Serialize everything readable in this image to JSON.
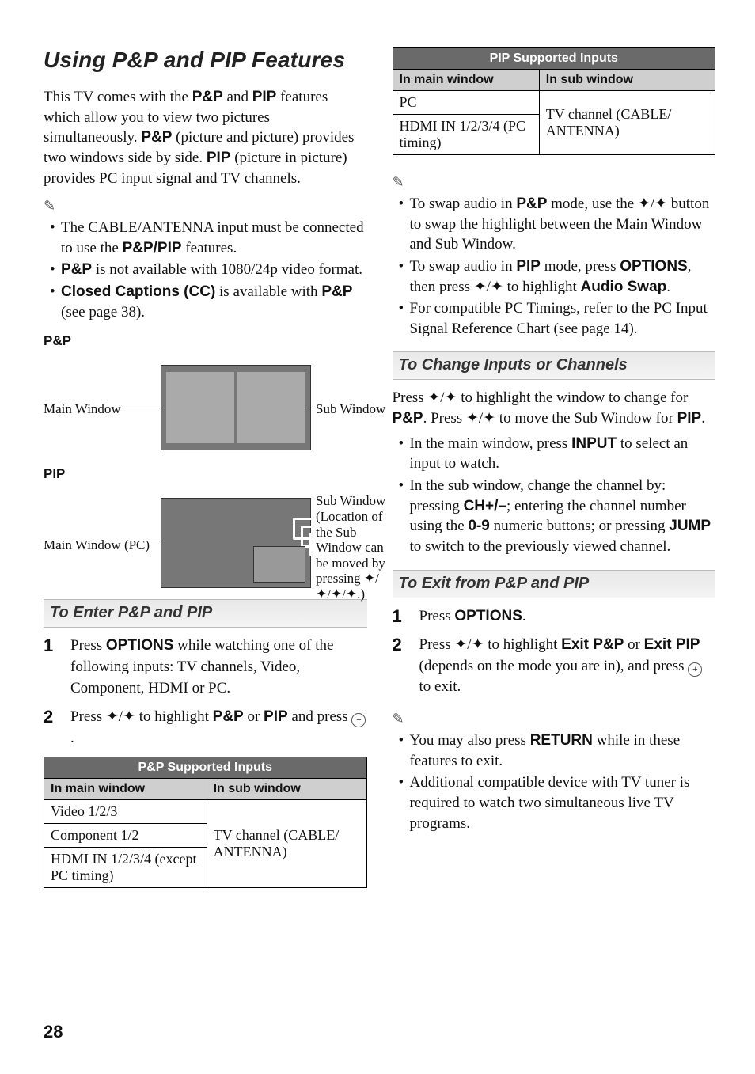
{
  "title": "Using P&P and PIP Features",
  "intro_parts": [
    "This TV comes with the ",
    "P&P",
    " and ",
    "PIP",
    " features which allow you to view two pictures simultaneously. ",
    "P&P",
    " (picture and picture) provides two windows side by side. ",
    "PIP",
    " (picture in picture) provides PC input signal and TV channels."
  ],
  "note_icon": "✎",
  "left_notes": [
    {
      "pre": "The CABLE/ANTENNA input must be connected to use the ",
      "bold": "P&P/PIP",
      "post": " features."
    },
    {
      "bold_first": "P&P",
      "post": " is not available with 1080/24p video format."
    },
    {
      "bold_first": "Closed Captions (CC)",
      "post": " is available with ",
      "bold2": "P&P",
      "post2": " (see page 38)."
    }
  ],
  "pp_label": "P&P",
  "pp_diagram": {
    "left": "Main Window",
    "right": "Sub Window"
  },
  "pip_label": "PIP",
  "pip_diagram": {
    "left": "Main Window (PC)",
    "right": "Sub Window (Location of the Sub Window can be moved by pressing ✦/✦/✦/✦.)"
  },
  "enter_heading": "To Enter P&P and PIP",
  "enter_steps": [
    {
      "parts": [
        "Press ",
        {
          "b": "OPTIONS"
        },
        " while watching one of the following inputs: TV channels, Video, Component, HDMI or PC."
      ]
    },
    {
      "parts": [
        "Press ✦/✦ to highlight ",
        {
          "b": "P&P"
        },
        " or ",
        {
          "b": "PIP"
        },
        " and press ",
        {
          "enter": true
        },
        "."
      ]
    }
  ],
  "table_pp": {
    "caption": "P&P Supported Inputs",
    "h1": "In main window",
    "h2": "In sub window",
    "main_rows": [
      "Video 1/2/3",
      "Component 1/2",
      "HDMI IN 1/2/3/4 (except PC timing)"
    ],
    "sub": "TV channel (CABLE/ ANTENNA)"
  },
  "table_pip": {
    "caption": "PIP Supported Inputs",
    "h1": "In main window",
    "h2": "In sub window",
    "main_rows": [
      "PC",
      "HDMI IN 1/2/3/4 (PC timing)"
    ],
    "sub": "TV channel (CABLE/ ANTENNA)"
  },
  "right_notes_top": [
    {
      "parts": [
        "To swap audio in ",
        {
          "b": "P&P"
        },
        " mode, use the ✦/✦ button to swap the highlight between the Main Window and Sub Window."
      ]
    },
    {
      "parts": [
        "To swap audio in ",
        {
          "b": "PIP"
        },
        " mode, press ",
        {
          "b": "OPTIONS"
        },
        ", then press ✦/✦ to highlight ",
        {
          "b": "Audio Swap"
        },
        "."
      ]
    },
    {
      "parts": [
        "For compatible PC Timings, refer to the PC Input Signal Reference Chart (see page 14)."
      ]
    }
  ],
  "change_heading": "To Change Inputs or Channels",
  "change_intro_parts": [
    "Press ✦/✦ to highlight the window to change for ",
    {
      "b": "P&P"
    },
    ". Press ✦/✦ to move the Sub Window for ",
    {
      "b": "PIP"
    },
    "."
  ],
  "change_bullets": [
    {
      "parts": [
        "In the main window, press ",
        {
          "b": "INPUT"
        },
        " to select an input to watch."
      ]
    },
    {
      "parts": [
        "In the sub window, change the channel by: pressing ",
        {
          "b": "CH+/–"
        },
        "; entering the channel number using the ",
        {
          "b": "0-9"
        },
        " numeric buttons; or pressing ",
        {
          "b": "JUMP"
        },
        " to switch to the previously viewed channel."
      ]
    }
  ],
  "exit_heading": "To Exit from P&P and PIP",
  "exit_steps": [
    {
      "parts": [
        "Press ",
        {
          "b": "OPTIONS"
        },
        "."
      ]
    },
    {
      "parts": [
        "Press ✦/✦ to highlight ",
        {
          "b": "Exit P&P"
        },
        " or ",
        {
          "b": "Exit PIP"
        },
        " (depends on the mode you are in), and press ",
        {
          "enter": true
        },
        " to exit."
      ]
    }
  ],
  "exit_notes": [
    {
      "parts": [
        "You may also press ",
        {
          "b": "RETURN"
        },
        " while in these features to exit."
      ]
    },
    {
      "parts": [
        "Additional compatible device with TV tuner is required to watch two simultaneous live TV programs."
      ]
    }
  ],
  "page_number": "28"
}
